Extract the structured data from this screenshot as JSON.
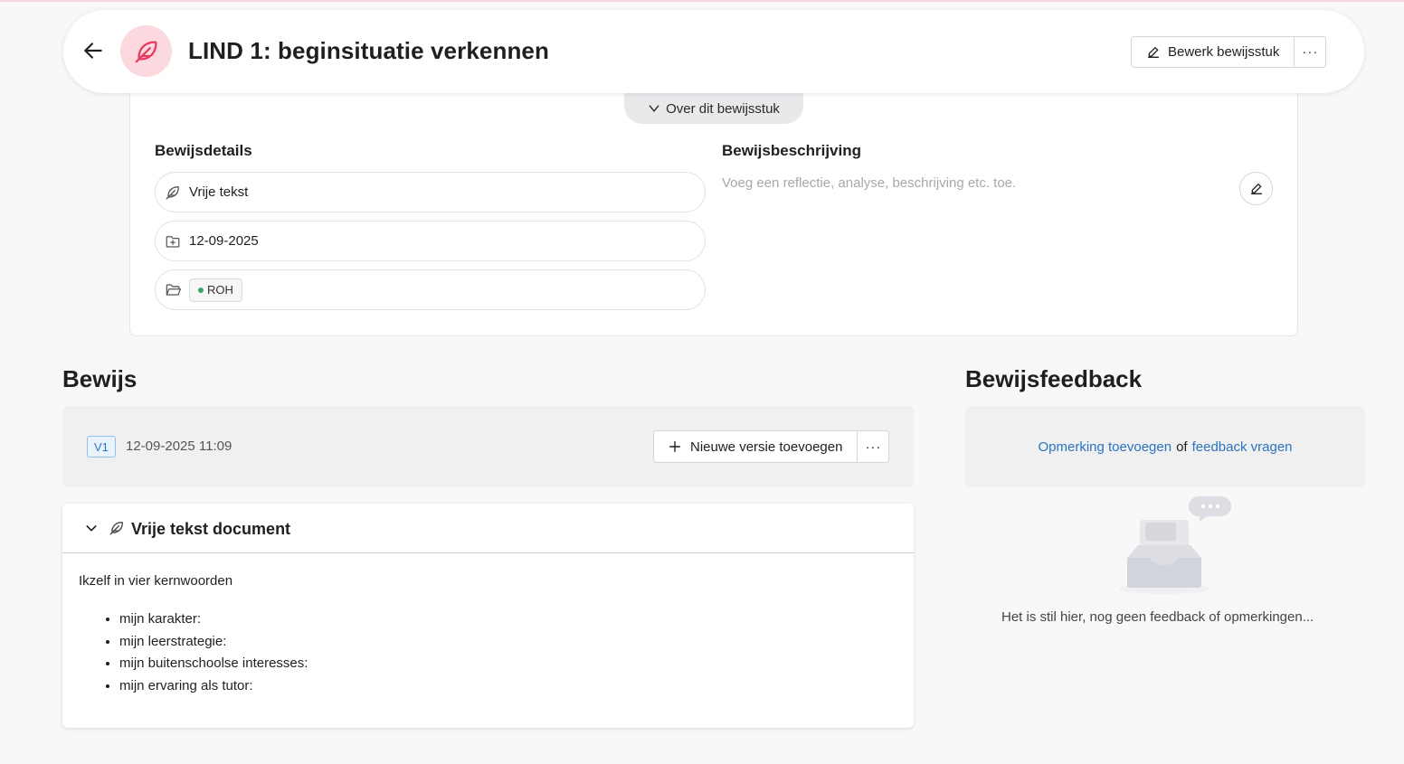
{
  "header": {
    "title": "LIND 1: beginsituatie verkennen",
    "edit_label": "Bewerk bewijsstuk",
    "more_label": "···",
    "accent_color": "#e8395f"
  },
  "details": {
    "toggle_label": "Over dit bewijsstuk",
    "details_title": "Bewijsdetails",
    "type_value": "Vrije tekst",
    "date_value": "12-09-2025",
    "folder_tag": "ROH",
    "description_title": "Bewijsbeschrijving",
    "description_placeholder": "Voeg een reflectie, analyse, beschrijving etc. toe."
  },
  "evidence": {
    "heading": "Bewijs",
    "version_badge": "V1",
    "version_date": "12-09-2025 11:09",
    "add_version_label": "Nieuwe versie toevoegen",
    "more_label": "···",
    "document": {
      "title": "Vrije tekst document",
      "intro": "Ikzelf in vier kernwoorden",
      "items": [
        "mijn karakter:",
        "mijn leerstrategie:",
        "mijn buitenschoolse interesses:",
        "mijn ervaring als tutor:"
      ]
    }
  },
  "feedback": {
    "heading": "Bewijsfeedback",
    "add_remark_link": "Opmerking toevoegen",
    "or_text": "of",
    "request_feedback_link": "feedback vragen",
    "empty_text": "Het is stil hier, nog geen feedback of opmerkingen..."
  }
}
